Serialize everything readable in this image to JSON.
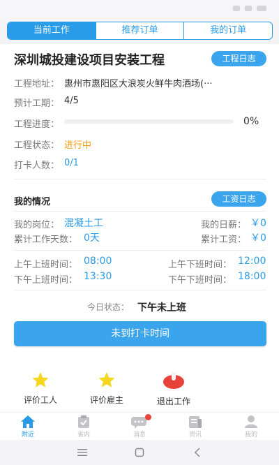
{
  "tabs": [
    {
      "label": "当前工作",
      "active": true
    },
    {
      "label": "推荐订单",
      "active": false
    },
    {
      "label": "我的订单",
      "active": false
    }
  ],
  "project": {
    "title": "深圳城投建设项目安装工程",
    "log_button": "工程日志",
    "address_label": "工程地址：",
    "address_value": "惠州市惠阳区大浪炭火鲜牛肉酒场(···",
    "period_label": "预计工期：",
    "period_value": "4/5",
    "progress_label": "工程进度：",
    "progress_value": "0%",
    "progress_fraction": 0,
    "status_label": "工程状态：",
    "status_value": "进行中",
    "checkin_label": "打卡人数：",
    "checkin_value": "0/1"
  },
  "my_situation": {
    "title": "我的情况",
    "wage_log_button": "工资日志",
    "post_label": "我的岗位：",
    "post_value": "混凝土工",
    "daily_label": "我的日薪：",
    "daily_value": "￥0",
    "days_label": "累计工作天数：",
    "days_value": "0天",
    "total_label": "累计工资：",
    "total_value": "￥0",
    "am_on_label": "上午上班时间：",
    "am_on_value": "08:00",
    "am_off_label": "上午下班时间：",
    "am_off_value": "12:00",
    "pm_off_label": "下午上班时间：",
    "pm_off_value": "13:30",
    "pm_end_label": "下午下班时间：",
    "pm_end_value": "18:00",
    "today_label": "今日状态：",
    "today_value": "下午未上班",
    "clock_button": "未到打卡时间"
  },
  "actions": [
    {
      "label": "评价工人",
      "icon": "star-icon"
    },
    {
      "label": "评价雇主",
      "icon": "star-icon"
    },
    {
      "label": "退出工作",
      "icon": "power-icon"
    }
  ],
  "bottom_nav": [
    {
      "label": "附近",
      "icon": "home-icon",
      "active": true
    },
    {
      "label": "省内",
      "icon": "clipboard-icon",
      "active": false
    },
    {
      "label": "消息",
      "icon": "message-icon",
      "active": false
    },
    {
      "label": "资讯",
      "icon": "news-icon",
      "active": false
    },
    {
      "label": "我的",
      "icon": "user-icon",
      "active": false
    }
  ],
  "colors": {
    "accent": "#2a9be8",
    "status_orange": "#f39a12",
    "star": "#f7d61d",
    "power": "#e8433a"
  }
}
